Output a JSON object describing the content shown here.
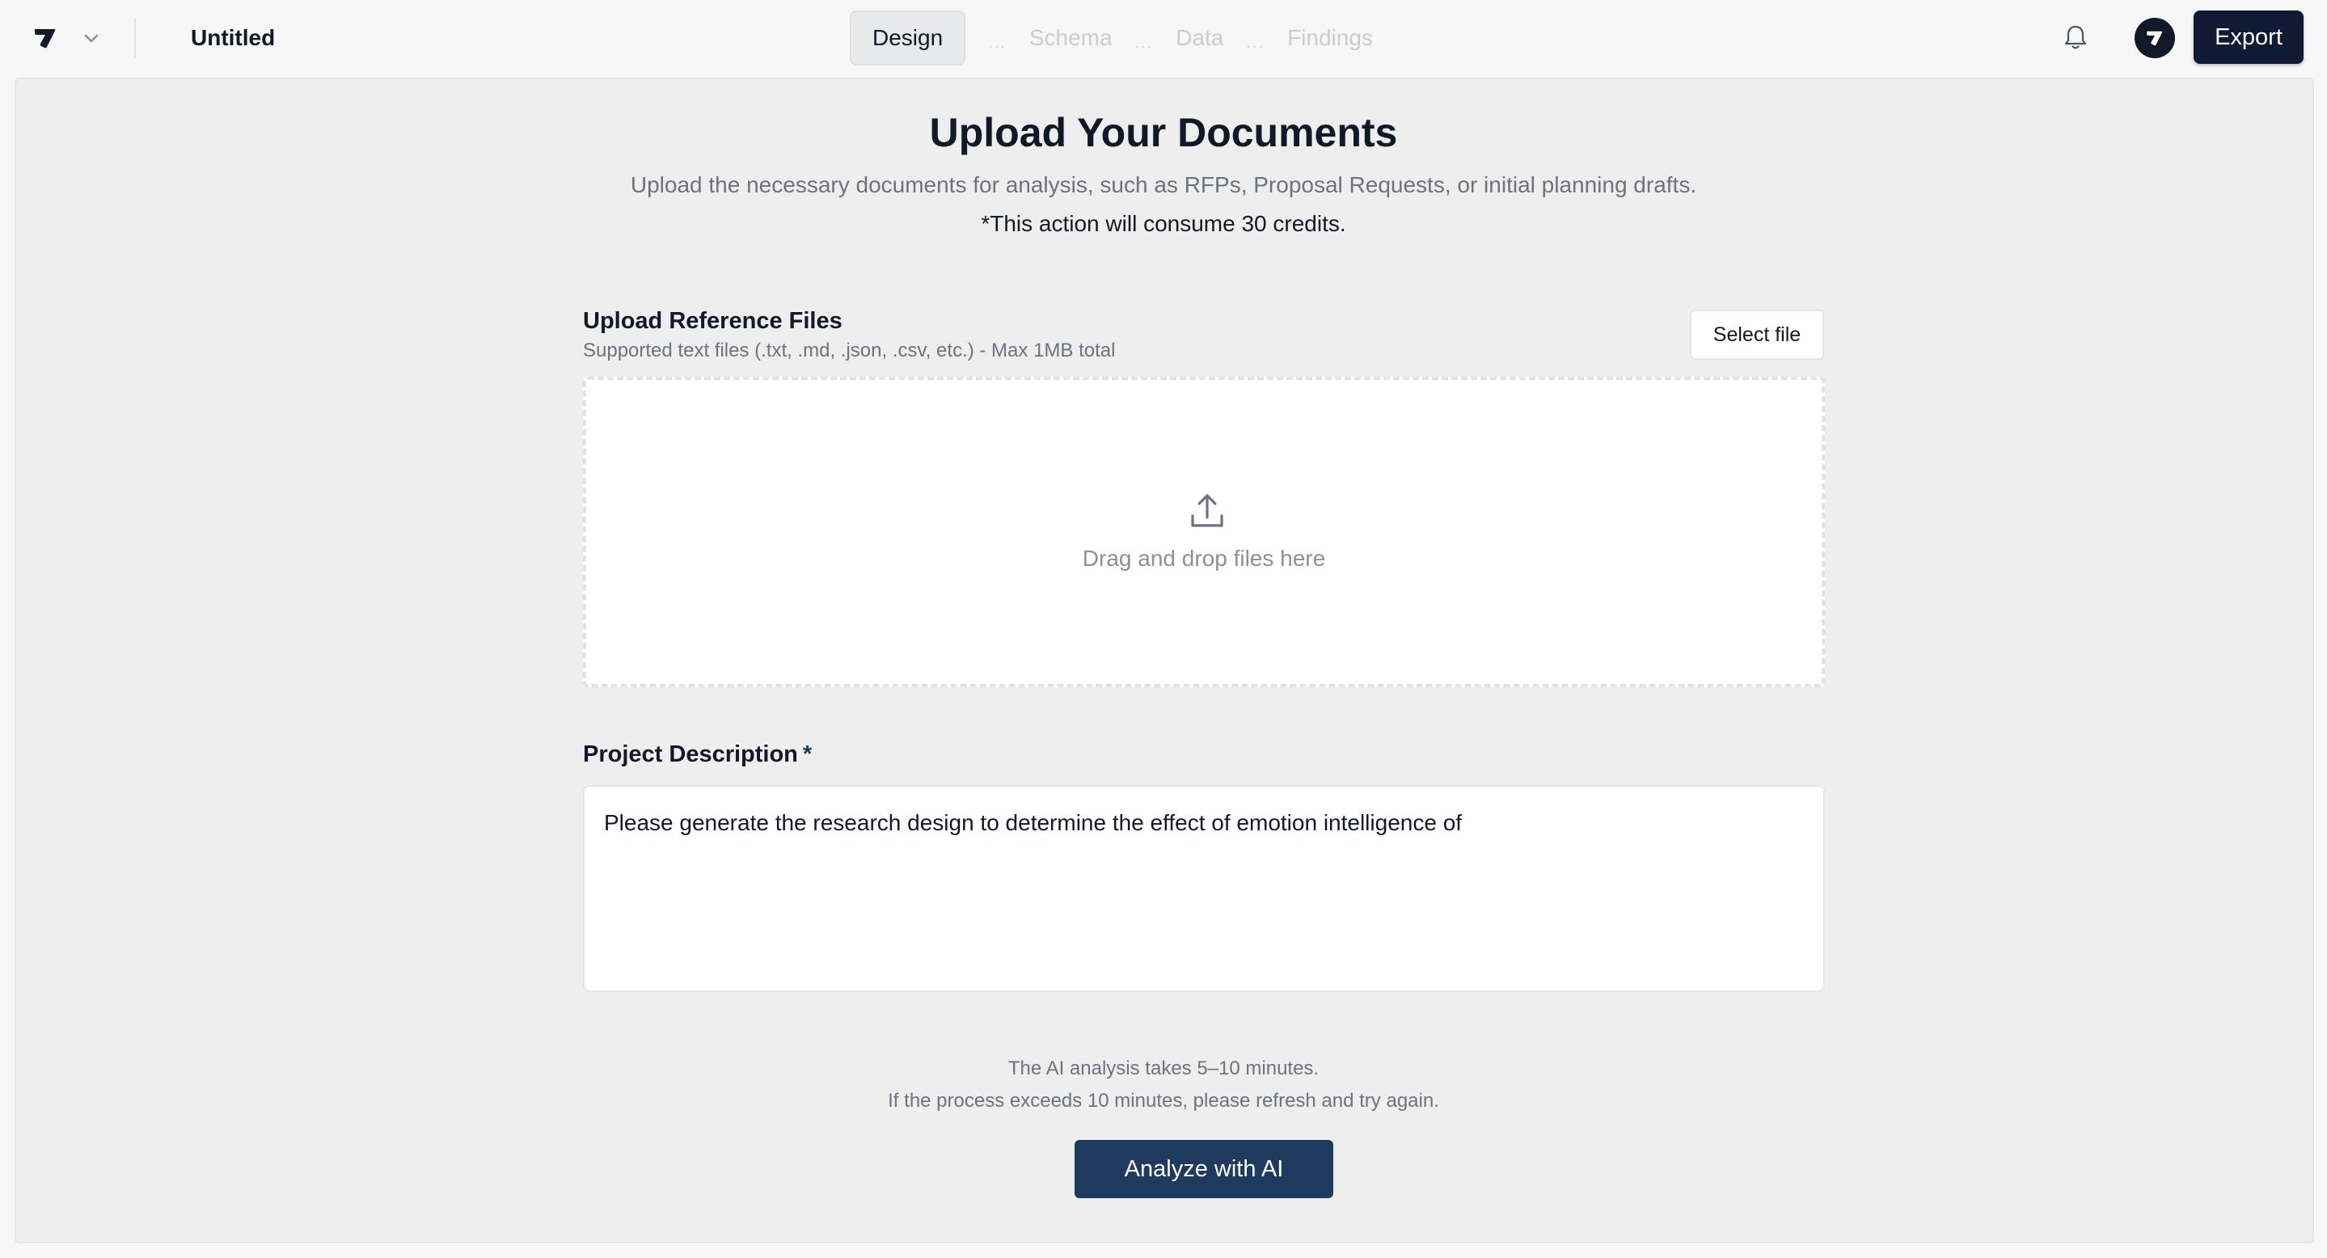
{
  "header": {
    "title": "Untitled",
    "export_label": "Export",
    "steps": [
      {
        "label": "Design",
        "active": true
      },
      {
        "label": "Schema",
        "active": false
      },
      {
        "label": "Data",
        "active": false
      },
      {
        "label": "Findings",
        "active": false
      }
    ],
    "step_separator": "...",
    "icons": {
      "logo": "brand-logo-icon",
      "menu": "chevron-down-icon",
      "notifications": "bell-icon",
      "avatar": "brand-avatar-icon"
    }
  },
  "main": {
    "heading": "Upload Your Documents",
    "subtext": "Upload the necessary documents for analysis, such as RFPs, Proposal Requests, or initial planning drafts.",
    "credits_note": "*This action will consume 30 credits.",
    "upload": {
      "label": "Upload Reference Files",
      "hint": "Supported text files (.txt, .md, .json, .csv, etc.) - Max 1MB total",
      "select_label": "Select file",
      "drop_text": "Drag and drop files here",
      "icon": "upload-icon"
    },
    "description": {
      "label": "Project Description",
      "required_marker": "*",
      "value": "Please generate the research design to determine the effect of emotion intelligence of"
    },
    "notes": [
      "The AI analysis takes 5–10 minutes.",
      "If the process exceeds 10 minutes, please refresh and try again."
    ],
    "analyze_label": "Analyze with AI"
  },
  "colors": {
    "primary": "#1e3a5f",
    "export_bg": "#0f1b33",
    "page_bg": "#f7f7f8",
    "panel_bg": "#eeeeee"
  }
}
